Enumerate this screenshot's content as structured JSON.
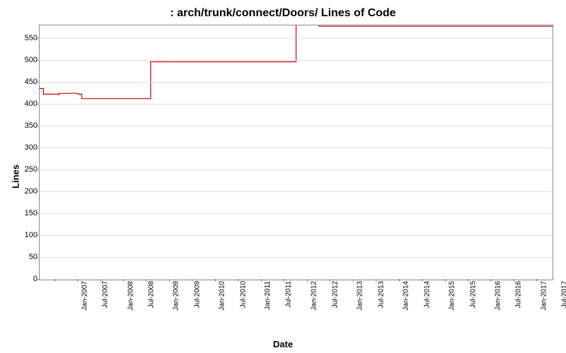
{
  "chart_data": {
    "type": "line",
    "title": ": arch/trunk/connect/Doors/ Lines of Code",
    "xlabel": "Date",
    "ylabel": "Lines",
    "ylim": [
      0,
      580
    ],
    "x_ticks": [
      "Jan-2007",
      "Jul-2007",
      "Jan-2008",
      "Jul-2008",
      "Jan-2009",
      "Jul-2009",
      "Jan-2010",
      "Jul-2010",
      "Jan-2011",
      "Jul-2011",
      "Jan-2012",
      "Jul-2012",
      "Jan-2013",
      "Jul-2013",
      "Jan-2014",
      "Jul-2014",
      "Jan-2015",
      "Jul-2015",
      "Jan-2016",
      "Jul-2016",
      "Jan-2017",
      "Jul-2017"
    ],
    "y_ticks": [
      0,
      50,
      100,
      150,
      200,
      250,
      300,
      350,
      400,
      450,
      500,
      550
    ],
    "series": [
      {
        "name": "Lines of Code",
        "color": "#d00000",
        "points": [
          {
            "x": "Sep-2006",
            "y": 436
          },
          {
            "x": "Oct-2006",
            "y": 423
          },
          {
            "x": "Jan-2007",
            "y": 423
          },
          {
            "x": "Feb-2007",
            "y": 420
          },
          {
            "x": "Feb-2007b",
            "y": 425
          },
          {
            "x": "Jul-2007",
            "y": 423
          },
          {
            "x": "Aug-2007",
            "y": 413
          },
          {
            "x": "Jan-2009",
            "y": 413
          },
          {
            "x": "Feb-2009",
            "y": 497
          },
          {
            "x": "Mar-2012",
            "y": 497
          },
          {
            "x": "Apr-2012",
            "y": 582
          },
          {
            "x": "Sep-2012",
            "y": 582
          },
          {
            "x": "Oct-2012",
            "y": 578
          },
          {
            "x": "Nov-2017",
            "y": 578
          }
        ]
      }
    ]
  }
}
